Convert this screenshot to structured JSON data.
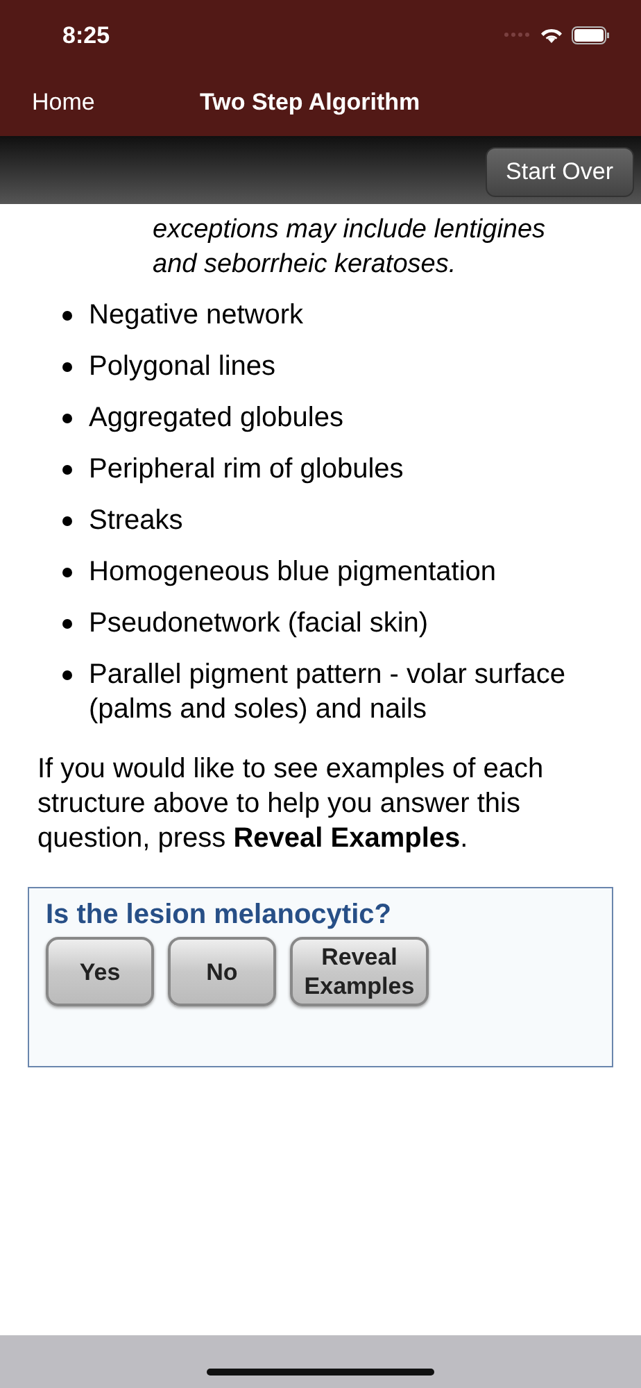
{
  "status_bar": {
    "time": "8:25"
  },
  "nav": {
    "back": "Home",
    "title": "Two Step Algorithm"
  },
  "toolbar": {
    "button": "Start Over"
  },
  "note_lines": [
    "exceptions may include lentigines",
    "and seborrheic keratoses."
  ],
  "bullets": [
    "Negative network",
    "Polygonal lines",
    "Aggregated globules",
    "Peripheral rim of globules",
    "Streaks",
    "Homogeneous blue pigmentation",
    "Pseudonetwork (facial skin)",
    "Parallel pigment pattern - volar surface (palms and soles) and nails"
  ],
  "paragraph": "If you would like to see examples of each structure above to help you answer this question, press **Reveal Examples**.",
  "question": {
    "title": "Is the lesion melanocytic?",
    "buttons": [
      "Yes",
      "No",
      "Reveal Examples"
    ]
  }
}
